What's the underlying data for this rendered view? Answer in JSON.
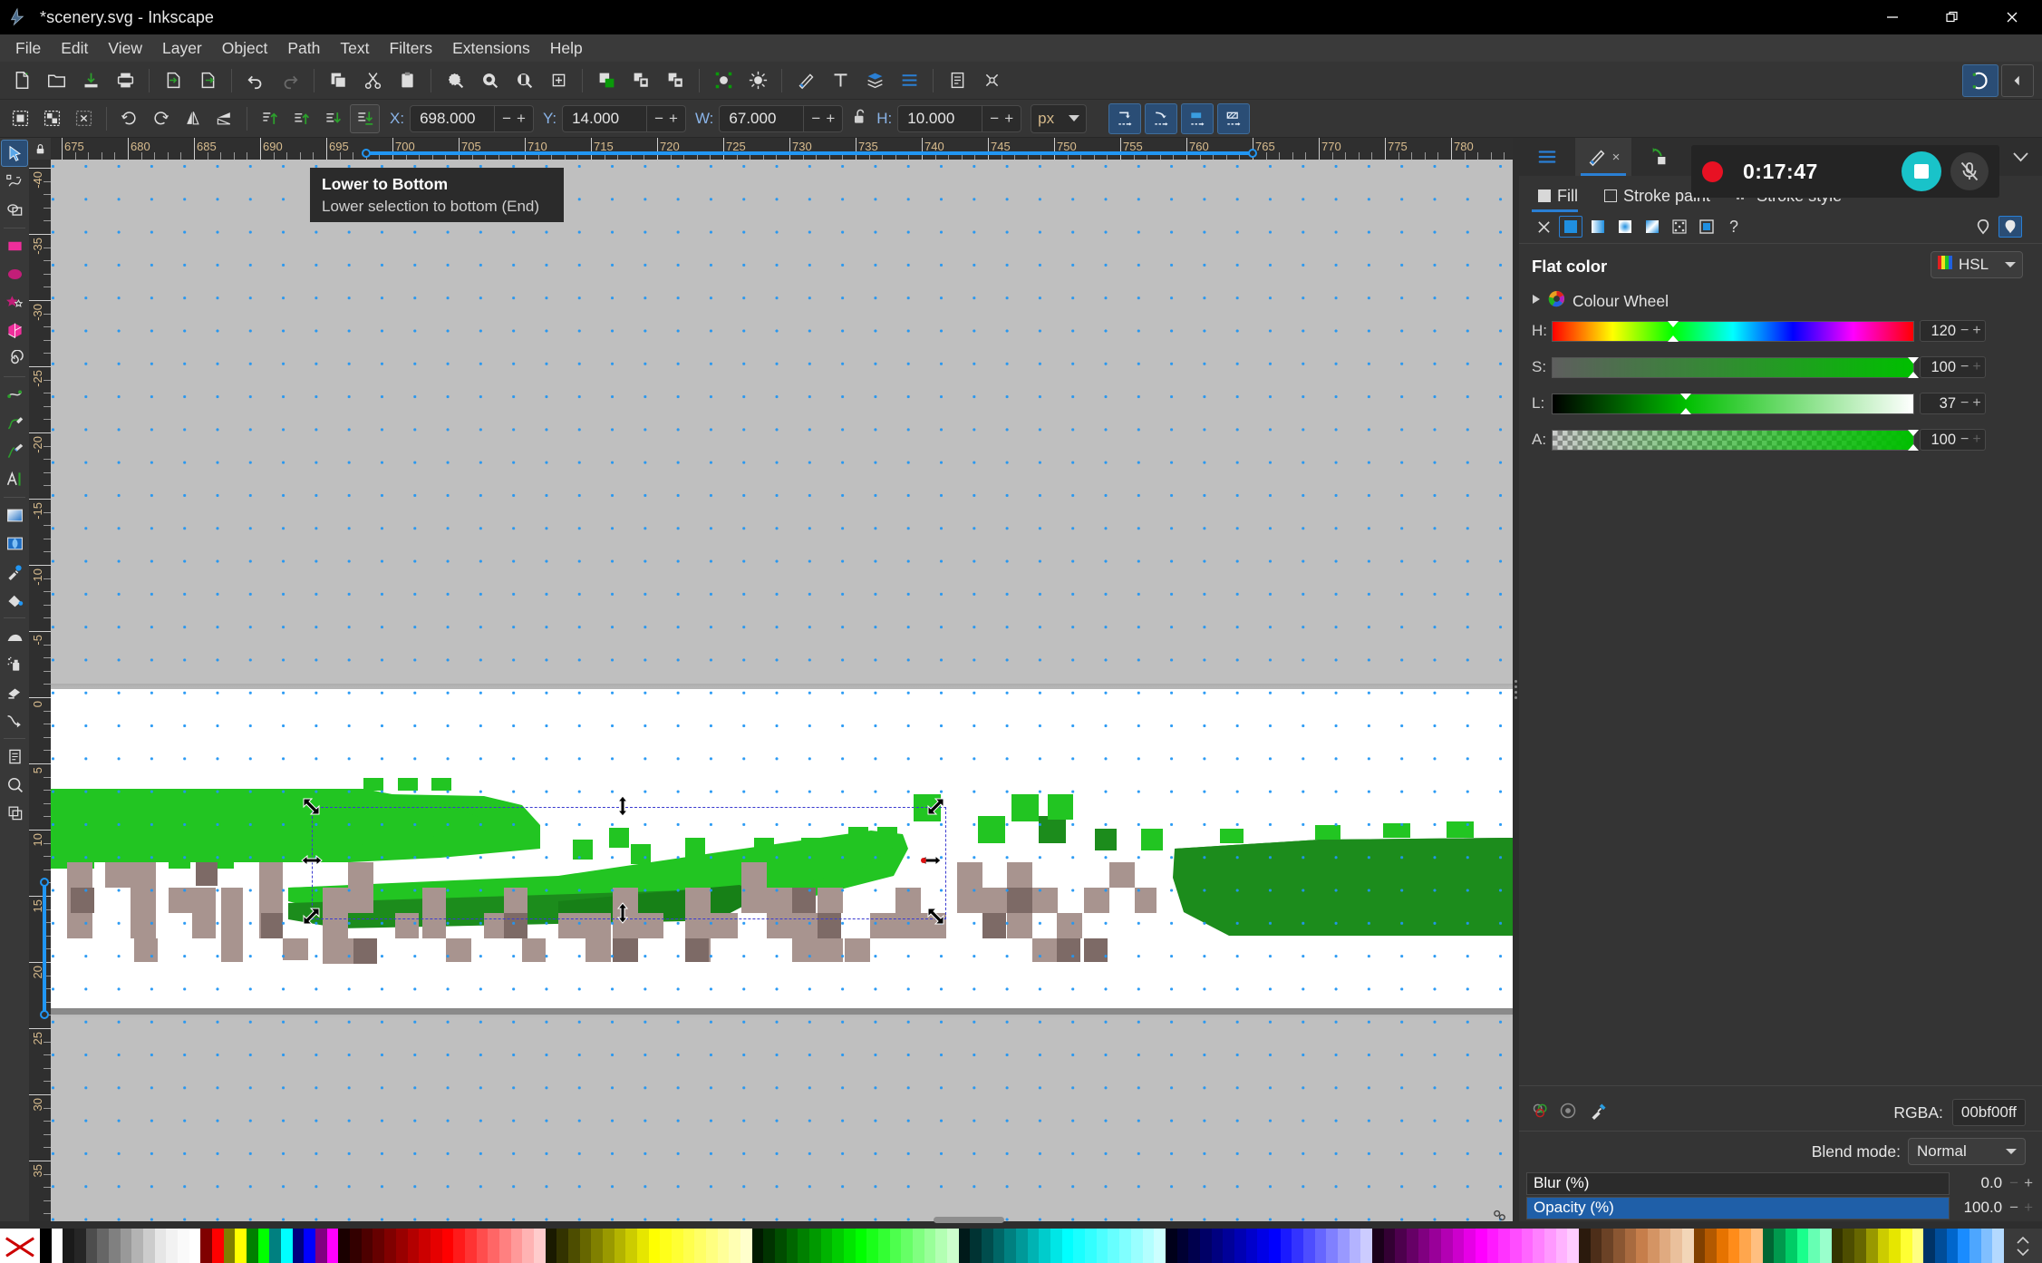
{
  "window": {
    "title": "*scenery.svg - Inkscape",
    "app_icon": "inkscape-logo",
    "controls": [
      {
        "name": "minimize-button",
        "glyph": "minimize-icon"
      },
      {
        "name": "restore-button",
        "glyph": "restore-icon"
      },
      {
        "name": "close-button",
        "glyph": "close-icon"
      }
    ]
  },
  "menubar": {
    "items": [
      "File",
      "Edit",
      "View",
      "Layer",
      "Object",
      "Path",
      "Text",
      "Filters",
      "Extensions",
      "Help"
    ]
  },
  "commandbar": {
    "groups": [
      [
        "new-document-icon",
        "open-document-icon",
        "save-document-icon",
        "print-icon"
      ],
      [
        "import-icon",
        "export-icon"
      ],
      [
        "undo-icon",
        "redo-icon"
      ],
      [
        "copy-icon",
        "cut-icon",
        "paste-icon"
      ],
      [
        "zoom-selection-icon",
        "zoom-drawing-icon",
        "zoom-page-icon",
        "zoom-fit-icon"
      ],
      [
        "duplicate-icon",
        "group-icon",
        "ungroup-icon"
      ],
      [
        "xml-editor-icon",
        "align-distribute-icon"
      ],
      [
        "fill-stroke-icon",
        "text-tool-icon",
        "objects-icon",
        "layers-icon"
      ],
      [
        "document-properties-icon",
        "preferences-icon"
      ]
    ],
    "right_buttons": [
      "snap-toggle-icon",
      "collapse-panel-icon"
    ]
  },
  "optionsbar": {
    "selection_buttons": [
      "select-all-icon",
      "select-all-layers-icon",
      "deselect-icon",
      "rotate-ccw-icon",
      "rotate-cw-icon",
      "flip-horizontal-icon",
      "flip-vertical-icon",
      "raise-to-top-icon",
      "raise-icon",
      "lower-icon",
      "lower-to-bottom-icon"
    ],
    "pressed_button": "lower-to-bottom-icon",
    "fields": [
      {
        "label": "X:",
        "value": "698.000"
      },
      {
        "label": "Y:",
        "value": "14.000"
      },
      {
        "label": "W:",
        "value": "67.000"
      },
      {
        "label": "H:",
        "value": "10.000"
      }
    ],
    "lock_icon": "lock-open-icon",
    "unit": "px",
    "affect_buttons": [
      "affect-stroke-width-icon",
      "affect-rounded-corners-icon",
      "affect-gradients-icon",
      "affect-patterns-icon"
    ]
  },
  "tooltip": {
    "title": "Lower to Bottom",
    "description": "Lower selection to bottom (End)"
  },
  "toolbox": {
    "active": "selector-tool",
    "tools": [
      {
        "name": "selector-tool",
        "icon": "cursor-arrow-icon"
      },
      {
        "name": "node-tool",
        "icon": "node-editor-icon"
      },
      {
        "name": "boolean-tool",
        "icon": "boolean-ops-icon"
      },
      {
        "name": "rectangle-tool",
        "icon": "rectangle-icon"
      },
      {
        "name": "ellipse-tool",
        "icon": "ellipse-icon"
      },
      {
        "name": "star-tool",
        "icon": "star-icon"
      },
      {
        "name": "box3d-tool",
        "icon": "cube-3d-icon"
      },
      {
        "name": "spiral-tool",
        "icon": "spiral-icon"
      },
      {
        "name": "pencil-tool",
        "icon": "pencil-icon"
      },
      {
        "name": "pen-tool",
        "icon": "bezier-pen-icon"
      },
      {
        "name": "calligraphy-tool",
        "icon": "calligraphy-icon"
      },
      {
        "name": "text-tool",
        "icon": "text-a-icon"
      },
      {
        "name": "gradient-tool",
        "icon": "gradient-icon"
      },
      {
        "name": "mesh-tool",
        "icon": "mesh-gradient-icon"
      },
      {
        "name": "dropper-tool",
        "icon": "eyedropper-icon"
      },
      {
        "name": "paintbucket-tool",
        "icon": "paint-bucket-icon"
      },
      {
        "name": "tweak-tool",
        "icon": "tweak-icon"
      },
      {
        "name": "spray-tool",
        "icon": "spray-can-icon"
      },
      {
        "name": "eraser-tool",
        "icon": "eraser-icon"
      },
      {
        "name": "connector-tool",
        "icon": "connector-icon"
      },
      {
        "name": "page-tool",
        "icon": "page-icon"
      },
      {
        "name": "zoom-tool",
        "icon": "magnifier-icon"
      },
      {
        "name": "measure-tool",
        "icon": "measure-icon"
      }
    ]
  },
  "rulers": {
    "horizontal": {
      "labels": [
        "675",
        "680",
        "685",
        "690",
        "695",
        "700",
        "705",
        "710",
        "715",
        "720",
        "725",
        "730",
        "735",
        "740",
        "745",
        "750",
        "755",
        "760",
        "765",
        "770",
        "775",
        "780"
      ],
      "start_value": 675,
      "step": 5,
      "selection_from": "698",
      "selection_to": "765"
    },
    "vertical": {
      "labels": [
        "-40",
        "-35",
        "-30",
        "-25",
        "-20",
        "-15",
        "-10",
        "-5",
        "0",
        "5",
        "10",
        "15",
        "20",
        "25",
        "30",
        "35"
      ],
      "selection_from": "14",
      "selection_to": "24"
    },
    "unit_corner_icon": "lock-icon"
  },
  "canvas": {
    "zoom_cursor_icons": [
      "resize-nw-icon",
      "resize-h-icon",
      "resize-ne-icon",
      "resize-sw-icon",
      "resize-v-icon",
      "resize-se-icon"
    ],
    "selection_bbox_label": "selected-object-bbox",
    "colors": {
      "green_bright": "#22c522",
      "green_mid": "#19ab19",
      "green_dark": "#1c8c1c",
      "green_darker": "#178017",
      "mauve": "#a8948f",
      "mauve_dark": "#7d6a66",
      "page_white": "#ffffff",
      "desk_gray": "#bfbfbf",
      "grid_dot": "#2196f3"
    }
  },
  "recording": {
    "time": "0:17:47",
    "record_dot": "record-dot-icon",
    "stop_icon": "stop-recording-icon",
    "mic_icon": "microphone-muted-icon",
    "accent": "#19c3c9",
    "dot_color": "#e81123"
  },
  "dock": {
    "tabs": [
      {
        "name": "dock-tab-layers",
        "icon": "layers-icon",
        "active": false
      },
      {
        "name": "dock-tab-fill-stroke",
        "icon": "fill-stroke-icon",
        "active": true,
        "close": "close-icon"
      },
      {
        "name": "dock-tab-objects",
        "icon": "objects-icon",
        "active": false
      }
    ],
    "collapse_icon": "chevron-down-icon"
  },
  "fill_stroke": {
    "tabs": [
      {
        "label": "Fill",
        "swatch": "filled",
        "active": true
      },
      {
        "label": "Stroke paint",
        "swatch": "hollow",
        "active": false
      },
      {
        "label": "Stroke style",
        "swatch": "dashes",
        "active": false
      }
    ],
    "paint_buttons": [
      {
        "name": "paint-none-button",
        "icon": "x-icon"
      },
      {
        "name": "paint-flat-button",
        "icon": "flat-color-icon",
        "selected": true
      },
      {
        "name": "paint-linear-gradient-button",
        "icon": "linear-gradient-icon"
      },
      {
        "name": "paint-radial-gradient-button",
        "icon": "radial-gradient-icon"
      },
      {
        "name": "paint-mesh-gradient-button",
        "icon": "mesh-gradient-icon"
      },
      {
        "name": "paint-pattern-button",
        "icon": "pattern-icon"
      },
      {
        "name": "paint-swatch-button",
        "icon": "swatch-icon"
      },
      {
        "name": "paint-unknown-button",
        "icon": "question-mark-icon"
      }
    ],
    "fillrule_buttons": [
      {
        "name": "fillrule-evenodd-button",
        "icon": "fill-rule-evenodd-icon"
      },
      {
        "name": "fillrule-nonzero-button",
        "icon": "fill-rule-nonzero-icon",
        "selected": true
      }
    ],
    "mode_label": "Flat color",
    "color_space": "HSL",
    "color_wheel_label": "Colour Wheel",
    "sliders": [
      {
        "label": "H:",
        "value": "120",
        "pos_pct": 33.3,
        "plus_dim": false
      },
      {
        "label": "S:",
        "value": "100",
        "pos_pct": 100,
        "plus_dim": true
      },
      {
        "label": "L:",
        "value": "37",
        "pos_pct": 37,
        "plus_dim": false
      },
      {
        "label": "A:",
        "value": "100",
        "pos_pct": 100,
        "plus_dim": true
      }
    ],
    "footer_icons": [
      "color-managed-icon",
      "target-icon",
      "pick-color-icon"
    ],
    "rgba_label": "RGBA:",
    "rgba_value": "00bf00ff",
    "blend_label": "Blend mode:",
    "blend_value": "Normal",
    "blur": {
      "label": "Blur (%)",
      "value": "0.0",
      "fill_pct": 0
    },
    "opacity": {
      "label": "Opacity (%)",
      "value": "100.0",
      "fill_pct": 100
    }
  },
  "palette": {
    "no_color_name": "no-color-swatch",
    "colors": [
      "#000000",
      "#ffffff",
      "#1a1a1a",
      "#262626",
      "#4d4d4d",
      "#666666",
      "#808080",
      "#999999",
      "#b3b3b3",
      "#cccccc",
      "#e6e6e6",
      "#f2f2f2",
      "#fafafa",
      "#ffffff",
      "#800000",
      "#ff0000",
      "#808000",
      "#ffff00",
      "#008000",
      "#00ff00",
      "#008080",
      "#00ffff",
      "#000080",
      "#0000ff",
      "#800080",
      "#ff00ff",
      "#1a0000",
      "#330000",
      "#4d0000",
      "#660000",
      "#800000",
      "#990000",
      "#b30000",
      "#cc0000",
      "#e60000",
      "#ff0000",
      "#ff1a1a",
      "#ff3333",
      "#ff4d4d",
      "#ff6666",
      "#ff8080",
      "#ff9999",
      "#ffb3b3",
      "#ffcccc",
      "#1a1a00",
      "#333300",
      "#4d4d00",
      "#666600",
      "#808000",
      "#999900",
      "#b3b300",
      "#cccc00",
      "#e6e600",
      "#ffff00",
      "#ffff1a",
      "#ffff33",
      "#ffff4d",
      "#ffff66",
      "#ffff80",
      "#ffff99",
      "#ffffb3",
      "#ffffcc",
      "#001a00",
      "#003300",
      "#004d00",
      "#006600",
      "#008000",
      "#009900",
      "#00b300",
      "#00cc00",
      "#00e600",
      "#00ff00",
      "#1aff1a",
      "#33ff33",
      "#4dff4d",
      "#66ff66",
      "#80ff80",
      "#99ff99",
      "#b3ffb3",
      "#ccffcc",
      "#001a1a",
      "#003333",
      "#004d4d",
      "#006666",
      "#008080",
      "#009999",
      "#00b3b3",
      "#00cccc",
      "#00e6e6",
      "#00ffff",
      "#1affff",
      "#33ffff",
      "#4dffff",
      "#66ffff",
      "#80ffff",
      "#99ffff",
      "#b3ffff",
      "#ccffff",
      "#00001a",
      "#000033",
      "#00004d",
      "#000066",
      "#000080",
      "#000099",
      "#0000b3",
      "#0000cc",
      "#0000e6",
      "#0000ff",
      "#1a1aff",
      "#3333ff",
      "#4d4dff",
      "#6666ff",
      "#8080ff",
      "#9999ff",
      "#b3b3ff",
      "#ccccff",
      "#1a001a",
      "#330033",
      "#4d004d",
      "#660066",
      "#800080",
      "#990099",
      "#b300b3",
      "#cc00cc",
      "#e600e6",
      "#ff00ff",
      "#ff1aff",
      "#ff33ff",
      "#ff4dff",
      "#ff66ff",
      "#ff80ff",
      "#ff99ff",
      "#ffb3ff",
      "#ffccff",
      "#2b1a0d",
      "#4d2e19",
      "#6b4226",
      "#8a5632",
      "#a86a3f",
      "#c67e4b",
      "#d49464",
      "#e0aa80",
      "#eac09c",
      "#f2d6b8",
      "#804000",
      "#b35900",
      "#e67300",
      "#ff8c1a",
      "#ffa64d",
      "#ffbf80",
      "#006633",
      "#00994d",
      "#00cc66",
      "#1aff8c",
      "#66ffb3",
      "#99ffcc",
      "#333300",
      "#4d4d00",
      "#666600",
      "#999900",
      "#cccc00",
      "#e6e600",
      "#ffff33",
      "#ffff80",
      "#003366",
      "#004d99",
      "#0066cc",
      "#1a8cff",
      "#4da6ff",
      "#80bfff",
      "#b3d9ff"
    ],
    "scroll_up_icon": "chevron-up-icon",
    "scroll_down_icon": "chevron-down-icon"
  }
}
